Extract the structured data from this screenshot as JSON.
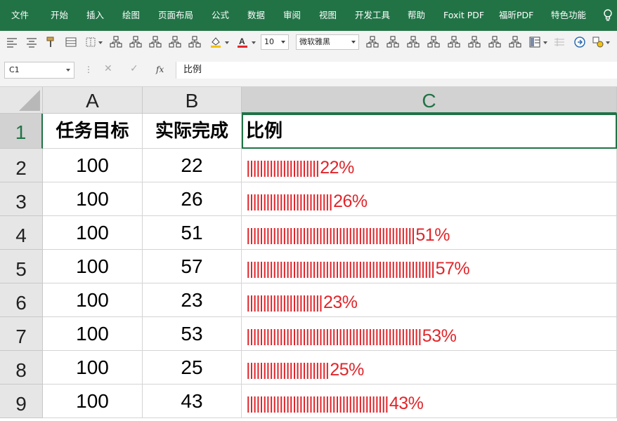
{
  "menu": [
    "文件",
    "开始",
    "插入",
    "绘图",
    "页面布局",
    "公式",
    "数据",
    "审阅",
    "视图",
    "开发工具",
    "帮助",
    "Foxit PDF",
    "福昕PDF",
    "特色功能"
  ],
  "toolbar": {
    "font_size": "10",
    "font_name": "微软雅黑",
    "colors": {
      "menu_bg": "#217346",
      "fill_accent": "#f4c20d",
      "font_accent": "#e0262b"
    }
  },
  "formula_bar": {
    "name_box": "C1",
    "cancel": "✕",
    "enter": "✓",
    "fx": "fx",
    "content": "比例"
  },
  "columns": [
    "A",
    "B",
    "C"
  ],
  "active_column": "C",
  "headers": [
    "任务目标",
    "实际完成",
    "比例"
  ],
  "rows": [
    {
      "num": "2",
      "target": "100",
      "actual": "22",
      "bar": "||||||||||||||||||||||",
      "pct": "22%"
    },
    {
      "num": "3",
      "target": "100",
      "actual": "26",
      "bar": "||||||||||||||||||||||||||",
      "pct": "26%"
    },
    {
      "num": "4",
      "target": "100",
      "actual": "51",
      "bar": "|||||||||||||||||||||||||||||||||||||||||||||||||||",
      "pct": "51%"
    },
    {
      "num": "5",
      "target": "100",
      "actual": "57",
      "bar": "|||||||||||||||||||||||||||||||||||||||||||||||||||||||||",
      "pct": "57%"
    },
    {
      "num": "6",
      "target": "100",
      "actual": "23",
      "bar": "|||||||||||||||||||||||",
      "pct": "23%"
    },
    {
      "num": "7",
      "target": "100",
      "actual": "53",
      "bar": "|||||||||||||||||||||||||||||||||||||||||||||||||||||",
      "pct": "53%"
    },
    {
      "num": "8",
      "target": "100",
      "actual": "25",
      "bar": "|||||||||||||||||||||||||",
      "pct": "25%"
    },
    {
      "num": "9",
      "target": "100",
      "actual": "43",
      "bar": "|||||||||||||||||||||||||||||||||||||||||||",
      "pct": "43%"
    }
  ],
  "header_row_num": "1"
}
